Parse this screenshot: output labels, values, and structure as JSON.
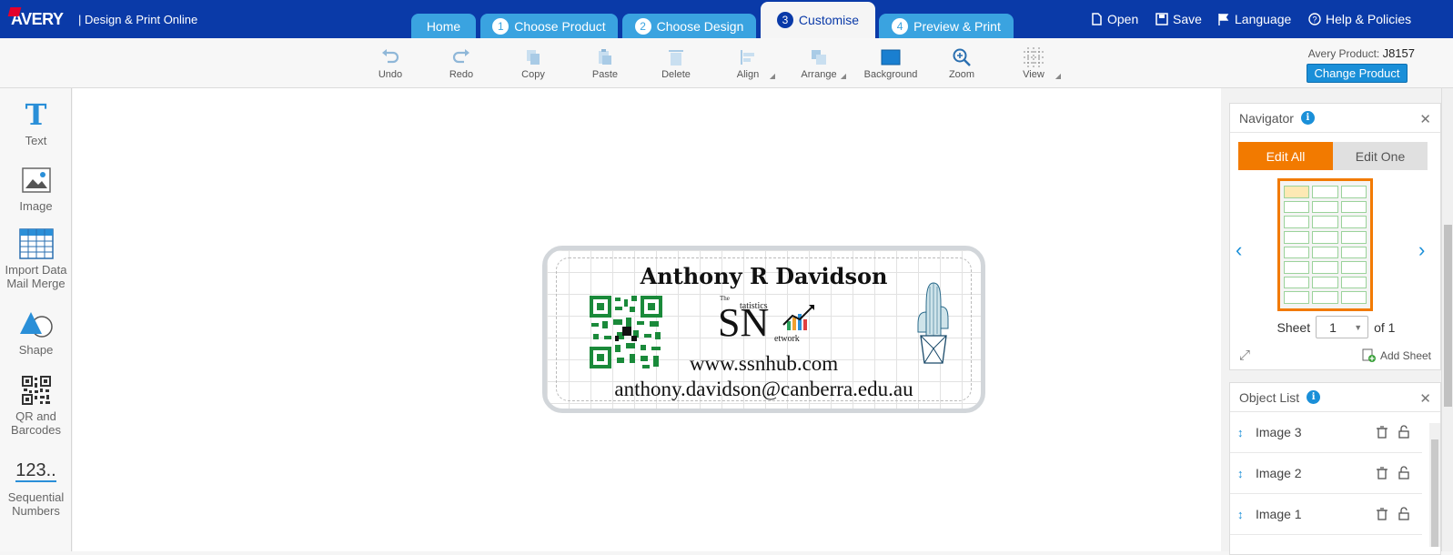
{
  "header": {
    "logo": "AVERY",
    "subtitle": "|  Design & Print Online",
    "tabs": [
      {
        "num": "",
        "label": "Home"
      },
      {
        "num": "1",
        "label": "Choose Product"
      },
      {
        "num": "2",
        "label": "Choose Design"
      },
      {
        "num": "3",
        "label": "Customise"
      },
      {
        "num": "4",
        "label": "Preview & Print"
      }
    ],
    "nav": {
      "open": "Open",
      "save": "Save",
      "language": "Language",
      "help": "Help & Policies"
    }
  },
  "toolbar": {
    "undo": "Undo",
    "redo": "Redo",
    "copy": "Copy",
    "paste": "Paste",
    "delete": "Delete",
    "align": "Align",
    "arrange": "Arrange",
    "background": "Background",
    "zoom": "Zoom",
    "view": "View",
    "product_label": "Avery Product:",
    "product_code": "J8157",
    "change_product": "Change Product"
  },
  "left_tools": {
    "text": "Text",
    "text_icon": "T",
    "image": "Image",
    "import": "Import Data\nMail Merge",
    "shape": "Shape",
    "qr": "QR and\nBarcodes",
    "sequential": "Sequential\nNumbers",
    "sequential_icon": "123.."
  },
  "label": {
    "name": "Anthony R Davidson",
    "url": "www.ssnhub.com",
    "email": "anthony.davidson@canberra.edu.au",
    "logo_small": "The",
    "logo_letters": "SN",
    "logo_word1": "tatistics",
    "logo_word2": "etwork"
  },
  "navigator": {
    "title": "Navigator",
    "edit_all": "Edit All",
    "edit_one": "Edit One",
    "sheet_label": "Sheet",
    "sheet_value": "1",
    "of_label": "of 1",
    "add_sheet": "Add Sheet"
  },
  "object_list": {
    "title": "Object List",
    "items": [
      "Image 3",
      "Image 2",
      "Image 1"
    ]
  },
  "colors": {
    "brand": "#0a3aa8",
    "tab": "#3aa3e0",
    "accent": "#f27a00",
    "button": "#1a8fd8"
  }
}
